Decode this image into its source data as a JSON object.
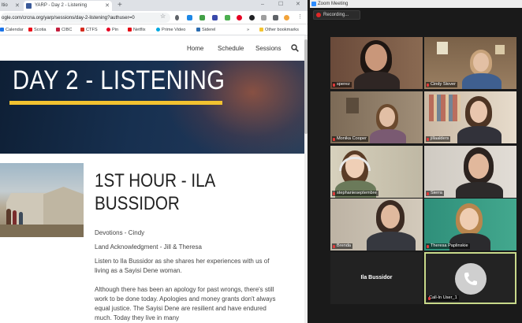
{
  "browser": {
    "tabs": [
      {
        "label": "ltio"
      },
      {
        "label": "YARP - Day 2 - Listening"
      }
    ],
    "new_tab_symbol": "+",
    "url": "ogle.com/crcna.org/yarp/sessions/day-2-listening?authuser=0",
    "bookmarks": [
      {
        "label": "Calendar",
        "color": "#1a73e8"
      },
      {
        "label": "Scotia",
        "color": "#ec111a"
      },
      {
        "label": "CIBC",
        "color": "#c41f3e"
      },
      {
        "label": "CTFS",
        "color": "#d52b1e"
      },
      {
        "label": "Pin",
        "color": "#e60023"
      },
      {
        "label": "Netflix",
        "color": "#e50914"
      },
      {
        "label": "Prime Video",
        "color": "#00a8e1"
      },
      {
        "label": "Siderel",
        "color": "#2b6cb0"
      },
      {
        "label": "Other bookmarks",
        "color": "#f4c430"
      }
    ],
    "bookmarks_more": "»"
  },
  "site": {
    "nav": [
      "Home",
      "Schedule",
      "Sessions"
    ],
    "hero_title": "DAY 2 - LISTENING",
    "section_title_line1": "1ST HOUR - ILA",
    "section_title_line2": "BUSSIDOR",
    "paragraphs": [
      "Devotions - Cindy",
      "Land Acknowledgment - Jill & Theresa",
      "Listen to Ila Bussidor as she shares her experiences with us of living as a Sayisi Dene woman.",
      "Although there has been an apology for past wrongs, there's still work to be done today. Apologies and money grants don't always equal justice. The Sayisi Dene are resilient and have endured much. Today they live in many"
    ],
    "accent_color": "#f2c230"
  },
  "zoom": {
    "window_title": "Zoom Meeting",
    "recording_label": "Recording...",
    "participants": [
      {
        "name": "sperez"
      },
      {
        "name": "Cindy Stover"
      },
      {
        "name": "Monika Cooper"
      },
      {
        "name": "jillaalders"
      },
      {
        "name": "stephanieseptembre"
      },
      {
        "name": "Sierra"
      },
      {
        "name": "Brenda"
      },
      {
        "name": "Theresa Paplinskie"
      },
      {
        "name": "Ila Bussidor"
      },
      {
        "name": "Call-In User_1"
      }
    ],
    "active_speaker_border": "#c8d98a"
  }
}
